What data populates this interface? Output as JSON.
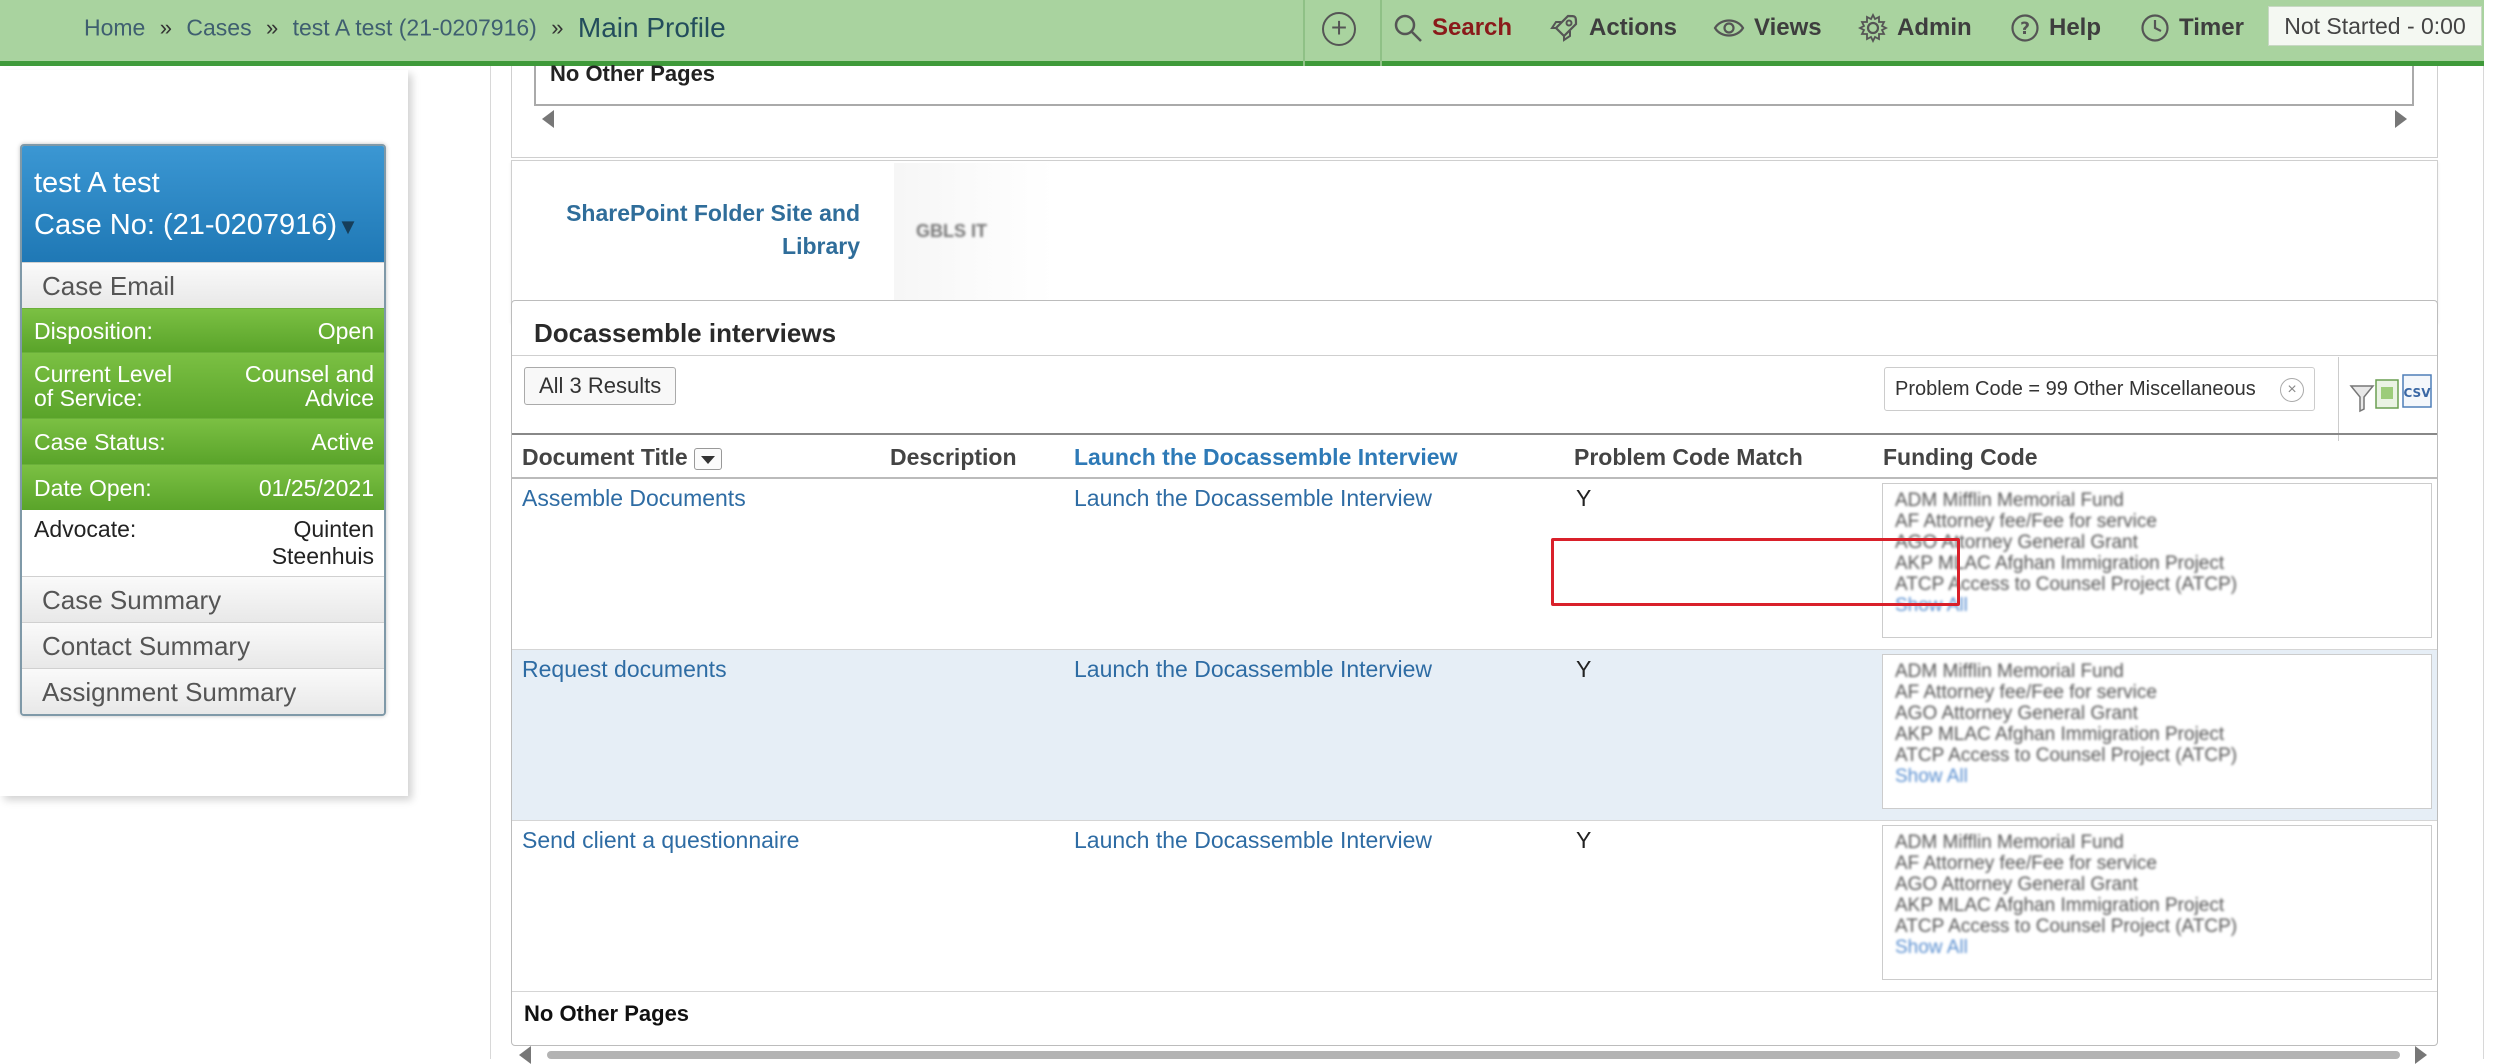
{
  "topbar": {
    "breadcrumbs": [
      "Home",
      "Cases",
      "test A test (21-0207916)"
    ],
    "separator": "»",
    "current": "Main Profile",
    "menu": {
      "search": "Search",
      "actions": "Actions",
      "views": "Views",
      "admin": "Admin",
      "help": "Help",
      "timer": "Timer"
    },
    "timer_status": "Not Started - 0:00",
    "icons": [
      "plus-circle-icon",
      "search-icon",
      "rocket-icon",
      "eye-icon",
      "gear-icon",
      "help-icon",
      "clock-icon"
    ]
  },
  "case_card": {
    "name": "test A test",
    "case_no": "Case No: (21-0207916)",
    "case_email": "Case Email",
    "fields": [
      {
        "label": "Disposition:",
        "value": "Open"
      },
      {
        "label": "Current Level of Service:",
        "value": "Counsel and Advice"
      },
      {
        "label": "Case Status:",
        "value": "Active"
      },
      {
        "label": "Date Open:",
        "value": "01/25/2021"
      }
    ],
    "advocate": {
      "label": "Advocate:",
      "value": "Quinten Steenhuis"
    },
    "links": [
      "Case Summary",
      "Contact Summary",
      "Assignment Summary"
    ]
  },
  "previous_section": {
    "no_pages": "No Other Pages"
  },
  "sharepoint": {
    "label": "SharePoint Folder Site and Library",
    "value": "GBLS IT"
  },
  "docassemble": {
    "title": "Docassemble interviews",
    "results_button": "All 3 Results",
    "filter": "Problem Code = 99 Other Miscellaneous",
    "columns": [
      "Document Title",
      "Description",
      "Launch the Docassemble Interview",
      "Problem Code Match",
      "Funding Code"
    ],
    "rows": [
      {
        "title": "Assemble Documents",
        "description": "",
        "launch": "Launch the Docassemble Interview",
        "match": "Y"
      },
      {
        "title": "Request documents",
        "description": "",
        "launch": "Launch the Docassemble Interview",
        "match": "Y"
      },
      {
        "title": "Send client a questionnaire",
        "description": "",
        "launch": "Launch the Docassemble Interview",
        "match": "Y"
      }
    ],
    "funding_codes": [
      "ADM Mifflin Memorial Fund",
      "AF Attorney fee/Fee for service",
      "AGO Attorney General Grant",
      "AKP MLAC Afghan Immigration Project",
      "ATCP Access to Counsel Project (ATCP)"
    ],
    "show_all": "Show All",
    "no_pages": "No Other Pages"
  },
  "colors": {
    "topbar_bg": "#a9d39f",
    "topbar_border": "#3f9a3a",
    "card_header": "#2b87c5",
    "card_green": "#6cb235",
    "link": "#2e6ca4",
    "highlight": "#d9202a"
  }
}
